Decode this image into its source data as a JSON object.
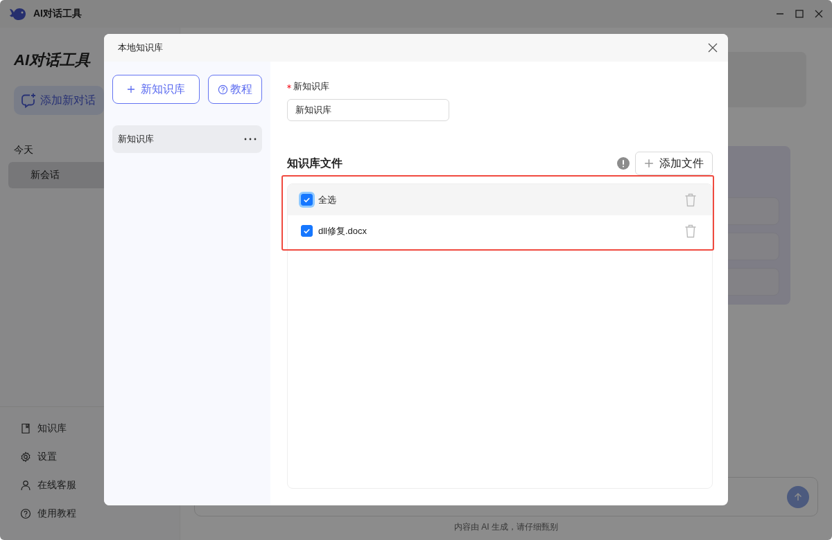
{
  "window": {
    "title": "AI对话工具"
  },
  "sidebar": {
    "brand": "AI对话工具",
    "new_chat_button": "添加新对话",
    "sections": [
      {
        "heading": "今天",
        "items": [
          {
            "label": "新会话",
            "selected": true
          }
        ]
      }
    ],
    "menu": [
      {
        "label": "知识库"
      },
      {
        "label": "设置"
      },
      {
        "label": "在线客服"
      },
      {
        "label": "使用教程"
      }
    ]
  },
  "main": {
    "disclaimer": "内容由 AI 生成，请仔细甄别"
  },
  "dialog": {
    "title": "本地知识库",
    "new_kb_button": "新知识库",
    "tutorial_button": "教程",
    "knowledge_bases": [
      {
        "name": "新知识库",
        "selected": true
      }
    ],
    "form": {
      "label": "新知识库",
      "required": true,
      "value": "新知识库"
    },
    "files_heading": "知识库文件",
    "add_file_button": "添加文件",
    "select_all": {
      "label": "全选",
      "checked": true
    },
    "files": [
      {
        "name": "dll修复.docx",
        "checked": true
      }
    ]
  }
}
